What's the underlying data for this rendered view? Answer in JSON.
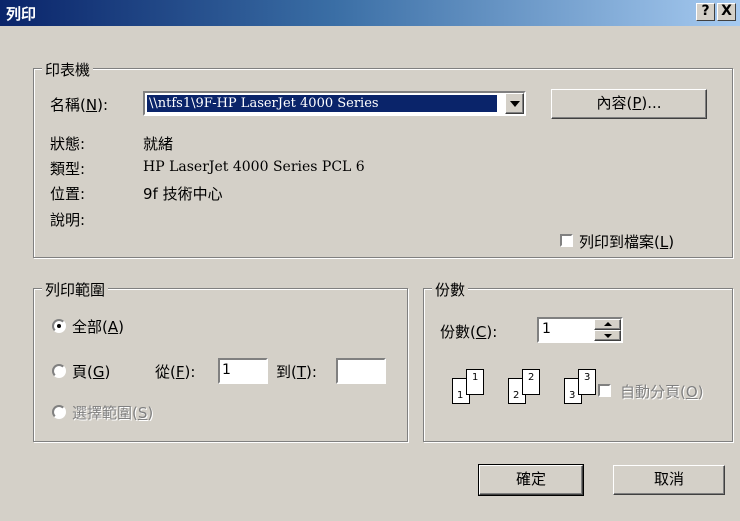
{
  "dialog": {
    "title": "列印",
    "help_btn": "?",
    "close_btn": "X"
  },
  "printer": {
    "legend": "印表機",
    "name_label": "名稱(",
    "name_key": "N",
    "name_suffix": "):",
    "name_value": "\\\\ntfs1\\9F-HP LaserJet 4000 Series",
    "properties_label": "內容(",
    "properties_key": "P",
    "properties_suffix": ")...",
    "status_label": "狀態:",
    "status_value": "就緒",
    "type_label": "類型:",
    "type_value": "HP LaserJet 4000 Series PCL 6",
    "location_label": "位置:",
    "location_value": "9f 技術中心",
    "comment_label": "說明:",
    "print_to_file_label": "列印到檔案(",
    "print_to_file_key": "L",
    "print_to_file_suffix": ")",
    "print_to_file_checked": false
  },
  "range": {
    "legend": "列印範圍",
    "all_label": "全部(",
    "all_key": "A",
    "all_suffix": ")",
    "pages_label": "頁(",
    "pages_key": "G",
    "pages_suffix": ")",
    "from_label": "從(",
    "from_key": "F",
    "from_suffix": "):",
    "from_value": "1",
    "to_label": "到(",
    "to_key": "T",
    "to_suffix": "):",
    "to_value": "",
    "selection_label": "選擇範圍(",
    "selection_key": "S",
    "selection_suffix": ")",
    "selected": "all"
  },
  "copies": {
    "legend": "份數",
    "count_label": "份數(",
    "count_key": "C",
    "count_suffix": "):",
    "count_value": "1",
    "page_numbers": [
      "1",
      "1",
      "2",
      "2",
      "3",
      "3"
    ],
    "collate_label": "自動分頁(",
    "collate_key": "O",
    "collate_suffix": ")"
  },
  "buttons": {
    "ok": "確定",
    "cancel": "取消"
  }
}
